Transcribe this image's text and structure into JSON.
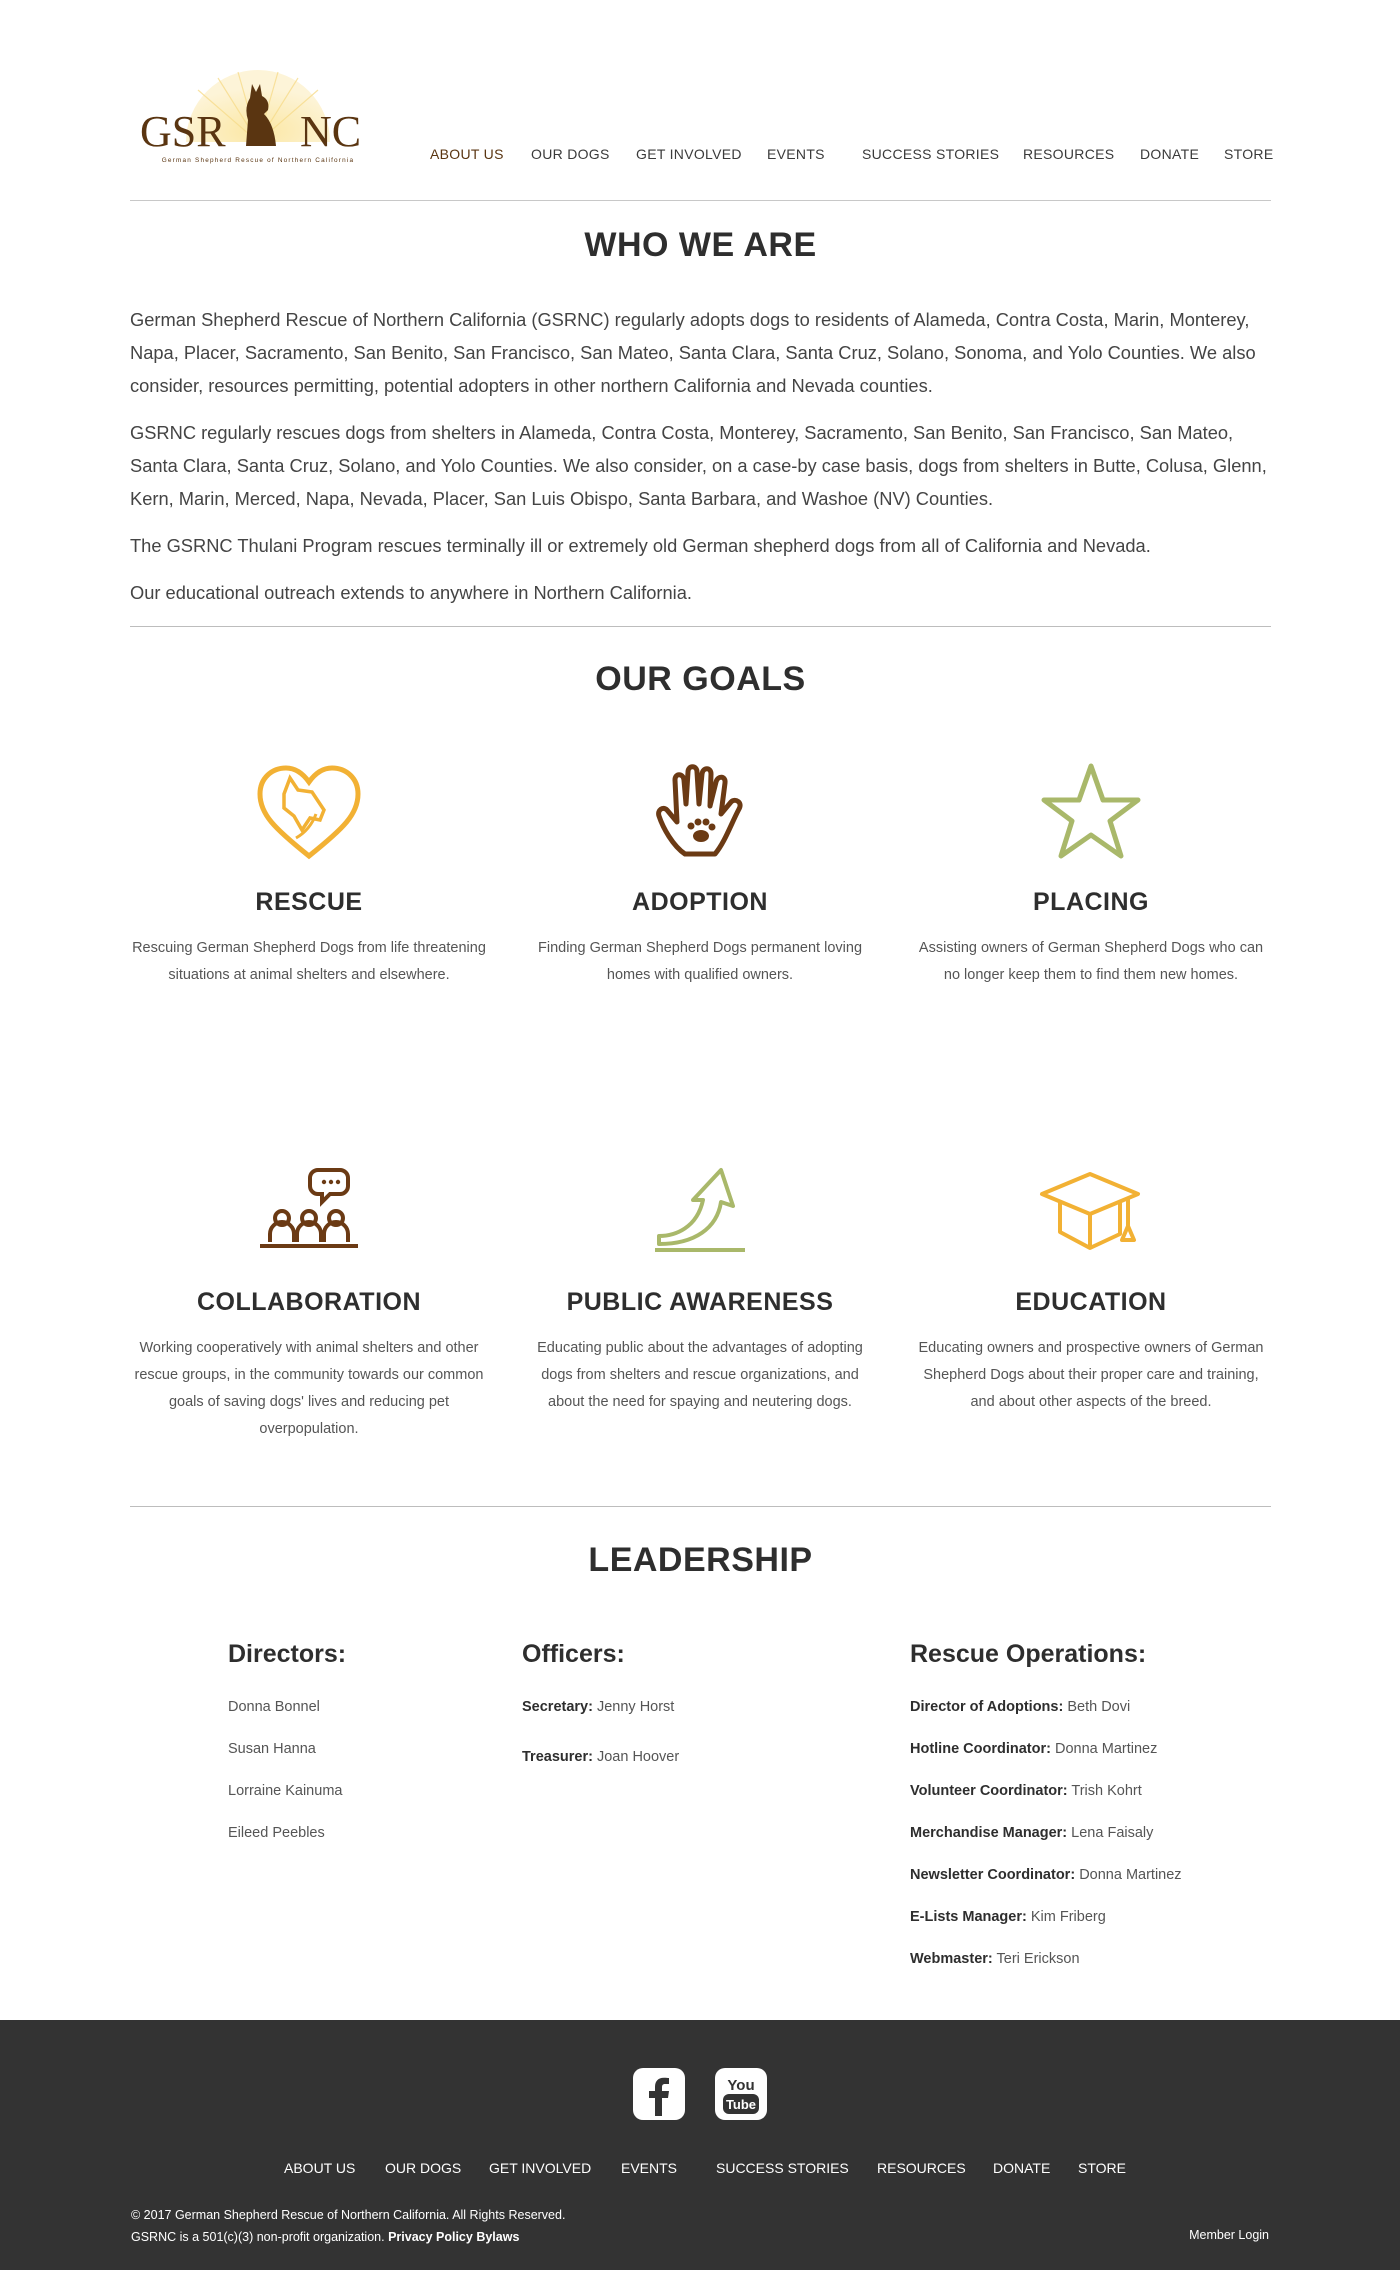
{
  "header": {
    "logo_text_left": "GSR",
    "logo_text_right": "NC",
    "logo_subtitle": "German Shepherd Rescue of Northern California",
    "nav": [
      "ABOUT US",
      "OUR DOGS",
      "GET INVOLVED",
      "EVENTS",
      "SUCCESS STORIES",
      "RESOURCES",
      "DONATE",
      "STORE"
    ],
    "active_nav": "ABOUT US"
  },
  "who_we_are": {
    "title": "WHO WE ARE",
    "paragraphs": [
      "German Shepherd Rescue of Northern California (GSRNC) regularly adopts dogs to residents of Alameda, Contra Costa, Marin, Monterey, Napa, Placer, Sacramento, San Benito, San Francisco, San Mateo, Santa Clara, Santa Cruz, Solano, Sonoma, and Yolo Counties. We also consider, resources permitting, potential adopters in other northern California and Nevada counties.",
      "GSRNC regularly rescues dogs from shelters in Alameda, Contra Costa, Monterey, Sacramento, San Benito, San Francisco, San Mateo, Santa Clara, Santa Cruz, Solano, and Yolo Counties. We also consider, on a case-by case basis, dogs from shelters in Butte, Colusa, Glenn, Kern, Marin, Merced, Napa, Nevada, Placer, San Luis Obispo, Santa Barbara, and Washoe (NV) Counties.",
      "The GSRNC Thulani Program rescues terminally ill or extremely old German shepherd dogs from all of California and Nevada.",
      "Our educational outreach extends to anywhere in Northern California."
    ]
  },
  "goals": {
    "title": "OUR GOALS",
    "items": [
      {
        "title": "RESCUE",
        "text": "Rescuing German Shepherd Dogs from life threatening situations at animal shelters and elsewhere.",
        "icon": "heart-dog-icon",
        "color": "#f2b134"
      },
      {
        "title": "ADOPTION",
        "text": "Finding German Shepherd Dogs permanent loving homes with qualified owners.",
        "icon": "hand-paw-icon",
        "color": "#6b3a14"
      },
      {
        "title": "PLACING",
        "text": "Assisting owners of German Shepherd Dogs who can no longer keep them to find them new homes.",
        "icon": "star-icon",
        "color": "#a9b86a"
      },
      {
        "title": "COLLABORATION",
        "text": "Working cooperatively with animal shelters and other rescue groups, in the community towards our common goals of saving dogs' lives and reducing pet overpopulation.",
        "icon": "people-chat-icon",
        "color": "#6b3a14"
      },
      {
        "title": "PUBLIC AWARENESS",
        "text": "Educating public about the advantages of adopting dogs from shelters and rescue organizations, and about the need for spaying and neutering dogs.",
        "icon": "arrow-up-icon",
        "color": "#a9b86a"
      },
      {
        "title": "EDUCATION",
        "text": "Educating owners and prospective owners of German Shepherd Dogs about their proper care and training, and about other aspects of the breed.",
        "icon": "graduation-cap-icon",
        "color": "#f2b134"
      }
    ]
  },
  "leadership": {
    "title": "LEADERSHIP",
    "directors": {
      "title": "Directors:",
      "names": [
        "Donna Bonnel",
        "Susan Hanna",
        "Lorraine Kainuma",
        "Eileed Peebles"
      ]
    },
    "officers": {
      "title": "Officers:",
      "rows": [
        {
          "role": "Secretary:",
          "name": "Jenny Horst"
        },
        {
          "role": "Treasurer:",
          "name": "Joan Hoover"
        }
      ]
    },
    "rescue_ops": {
      "title": "Rescue Operations:",
      "rows": [
        {
          "role": "Director of Adoptions:",
          "name": "Beth Dovi"
        },
        {
          "role": "Hotline Coordinator:",
          "name": "Donna Martinez"
        },
        {
          "role": "Volunteer Coordinator:",
          "name": "Trish Kohrt"
        },
        {
          "role": "Merchandise Manager:",
          "name": "Lena Faisaly"
        },
        {
          "role": "Newsletter Coordinator:",
          "name": "Donna Martinez"
        },
        {
          "role": "E-Lists Manager:",
          "name": "Kim Friberg"
        },
        {
          "role": "Webmaster:",
          "name": "Teri Erickson"
        }
      ]
    }
  },
  "footer": {
    "youtube_top": "You",
    "youtube_bottom": "Tube",
    "nav": [
      "ABOUT US",
      "OUR DOGS",
      "GET INVOLVED",
      "EVENTS",
      "SUCCESS STORIES",
      "RESOURCES",
      "DONATE",
      "STORE"
    ],
    "copyright": "©  2017 German Shepherd Rescue of Northern California. All Rights Reserved.",
    "nonprofit": "GSRNC is a 501(c)(3) non-profit organization.",
    "privacy": "Privacy Policy",
    "bylaws": "Bylaws",
    "member_login": "Member Login"
  }
}
